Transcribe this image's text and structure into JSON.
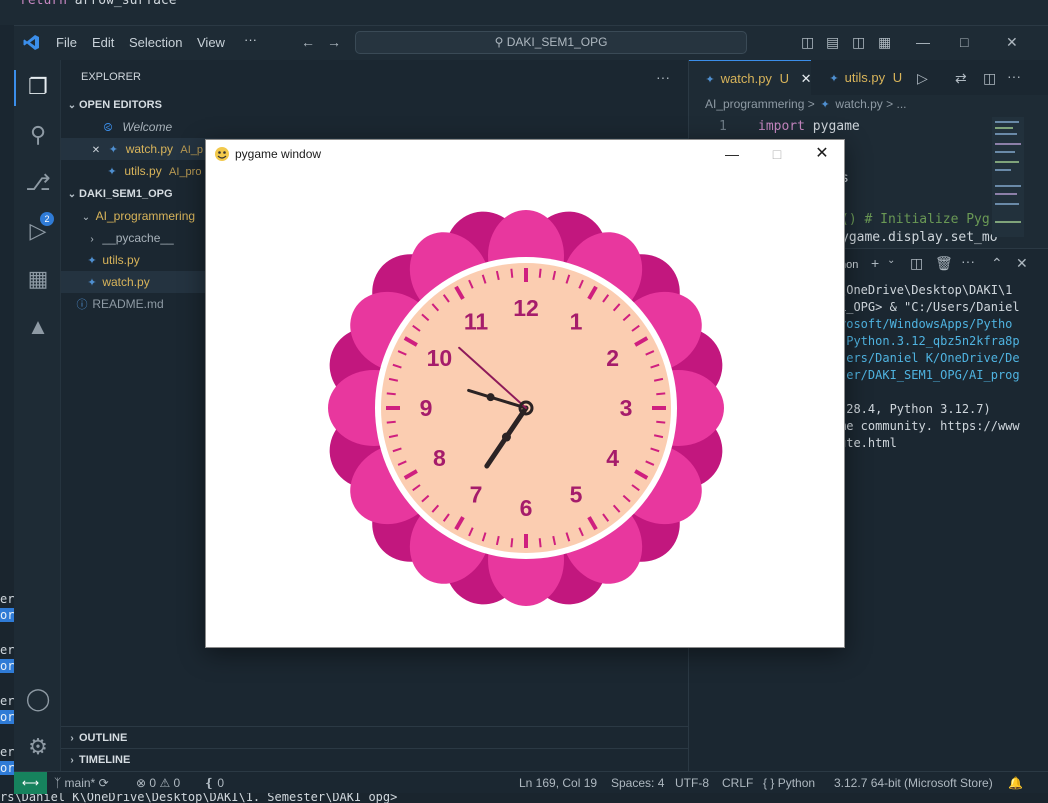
{
  "background": {
    "top_code_keyword": "return",
    "top_code_rest": "arrow_surface",
    "bottom_terminal": "rs\\Daniel K\\OneDrive\\Desktop\\DAKI\\1. Semester\\DAKI_opg>",
    "left_peek": [
      "er:",
      "or",
      "er:",
      "or",
      "er:",
      "or",
      "er:",
      "or"
    ]
  },
  "vscode": {
    "menu": [
      "File",
      "Edit",
      "Selection",
      "View",
      "···"
    ],
    "search_text": "DAKI_SEM1_OPG",
    "activity": {
      "source_control_badge": "2"
    },
    "explorer": {
      "title": "EXPLORER",
      "more": "···",
      "open_editors_header": "OPEN EDITORS",
      "open_editors": [
        {
          "name": "Welcome",
          "path": ""
        },
        {
          "name": "watch.py",
          "path": "AI_p"
        },
        {
          "name": "utils.py",
          "path": "AI_pro"
        }
      ],
      "folder_header": "DAKI_SEM1_OPG",
      "tree": [
        "AI_programmering",
        "__pycache__",
        "utils.py",
        "watch.py",
        "README.md"
      ],
      "outline": "OUTLINE",
      "timeline": "TIMELINE"
    },
    "tabs": [
      {
        "name": "watch.py",
        "status": "U"
      },
      {
        "name": "utils.py",
        "status": "U"
      }
    ],
    "breadcrumb": [
      "AI_programmering",
      ">",
      "watch.py",
      ">",
      "..."
    ],
    "code": {
      "line_number": "1",
      "line_keyword": "import",
      "line_rest": " pygame",
      "fragment_s": "s",
      "fragment_init": "() # Initialize Pyg",
      "fragment_display": "ygame.display.set_mo"
    },
    "panel": {
      "shell_label": "hon",
      "lines": [
        "\\OneDrive\\Desktop\\DAKI\\1",
        "L_OPG> & \"C:/Users/Daniel",
        "rosoft/WindowsApps/Pytho",
        ".Python.3.12_qbz5n2kfra8p",
        "sers/Daniel K/OneDrive/De",
        "ter/DAKI_SEM1_OPG/AI_prog",
        "",
        ".28.4, Python 3.12.7)",
        "me community. https://www",
        "ute.html"
      ]
    },
    "status": {
      "branch": "main*",
      "errors": "0",
      "warnings": "0",
      "ports": "0",
      "position": "Ln 169, Col 19",
      "spaces": "Spaces: 4",
      "encoding": "UTF-8",
      "eol": "CRLF",
      "language": "Python",
      "interpreter": "3.12.7 64-bit (Microsoft Store)"
    }
  },
  "pygame_window": {
    "title": "pygame window",
    "clock": {
      "numerals": [
        "12",
        "1",
        "2",
        "3",
        "4",
        "5",
        "6",
        "7",
        "8",
        "9",
        "10",
        "11"
      ],
      "hour_hand_deg": 214,
      "minute_hand_deg": 287,
      "second_hand_deg": 312,
      "colors": {
        "petal_dark": "#c2177e",
        "petal_light": "#e8379e",
        "face": "#fbcdb1",
        "ticks": "#cf1f7f",
        "numerals": "#a51c6b",
        "hands": "#2b2324",
        "second_hand": "#8e1a5a"
      }
    }
  }
}
